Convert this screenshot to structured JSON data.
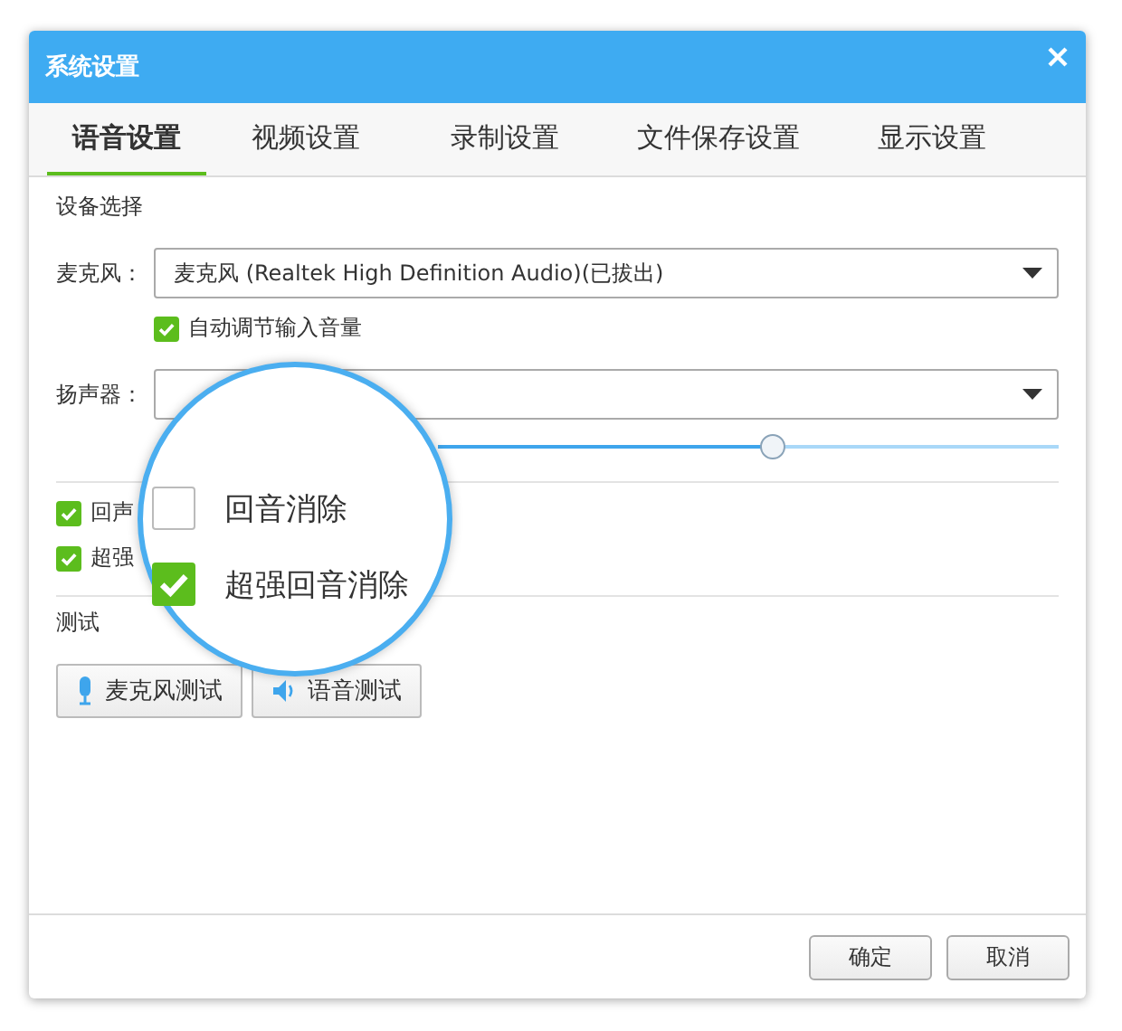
{
  "window": {
    "title": "系统设置"
  },
  "tabs": [
    {
      "label": "语音设置",
      "selected": true
    },
    {
      "label": "视频设置",
      "selected": false
    },
    {
      "label": "录制设置",
      "selected": false
    },
    {
      "label": "文件保存设置",
      "selected": false
    },
    {
      "label": "显示设置",
      "selected": false
    }
  ],
  "device_section": {
    "title": "设备选择"
  },
  "microphone": {
    "label": "麦克风：",
    "value": "麦克风 (Realtek High Definition Audio)(已拔出)",
    "auto_adjust": {
      "label": "自动调节输入音量",
      "checked": true
    }
  },
  "speaker": {
    "label": "扬声器：",
    "volume": {
      "level": 0.54
    }
  },
  "echo_options": [
    {
      "label": "回声",
      "checked": true
    },
    {
      "label": "超强",
      "checked": true
    }
  ],
  "test_section": {
    "title": "测试",
    "buttons": [
      {
        "label": "麦克风测试",
        "kind": "microphone"
      },
      {
        "label": "语音测试",
        "kind": "speaker"
      }
    ]
  },
  "magnifier": {
    "options": [
      {
        "label": "回音消除",
        "checked": false
      },
      {
        "label": "超强回音消除",
        "checked": true
      }
    ]
  },
  "footer_buttons": [
    "确定",
    "取消"
  ]
}
